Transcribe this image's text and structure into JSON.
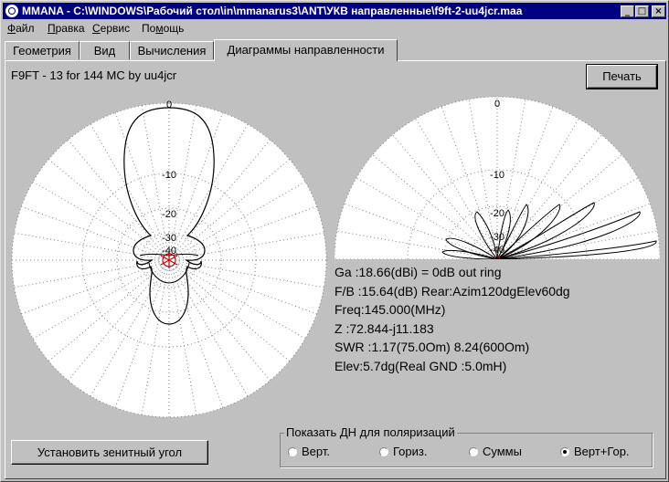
{
  "window": {
    "title": "MMANA - C:\\WINDOWS\\Рабочий стол\\in\\mmanarus3\\ANT\\УКВ направленные\\f9ft-2-uu4jcr.maa",
    "min_label": "_",
    "max_label": "□",
    "close_label": "×"
  },
  "menu": [
    {
      "u": "Ф",
      "rest": "айл"
    },
    {
      "u": "П",
      "rest": "равка"
    },
    {
      "u": "С",
      "rest": "ервис"
    },
    {
      "pre": "По",
      "u": "м",
      "rest": "ощь"
    }
  ],
  "tabs": [
    "Геометрия",
    "Вид",
    "Вычисления",
    "Диаграммы направленности"
  ],
  "active_tab": 3,
  "antenna_title": "F9FT - 13 for 144 MC by uu4jcr",
  "print_button": "Печать",
  "horizontal_plot": {
    "ring_labels": [
      "0",
      "-10",
      "-20",
      "-30",
      "-40"
    ],
    "line_color": "#000000",
    "aux_color": "#cc0000"
  },
  "vertical_plot": {
    "ring_labels": [
      "0",
      "-10",
      "-20",
      "-30",
      "-40"
    ]
  },
  "info": {
    "ga": "Ga  :18.66(dBi) = 0dB  out ring",
    "fb": "F/B :15.64(dB) Rear:Azim120dgElev60dg",
    "freq": "Freq:145.000(MHz)",
    "z": "Z    :72.844-j11.183",
    "swr": "SWR :1.17(75.0Om) 8.24(600Om)",
    "elev": "Elev:5.7dg(Real GND :5.0mH)"
  },
  "zenith_button": "Установить зенитный угол",
  "polarization": {
    "legend": "Показать ДН для поляризаций",
    "options": [
      "Верт.",
      "Гориз.",
      "Суммы",
      "Верт+Гор."
    ],
    "selected": "Верт+Гор."
  }
}
